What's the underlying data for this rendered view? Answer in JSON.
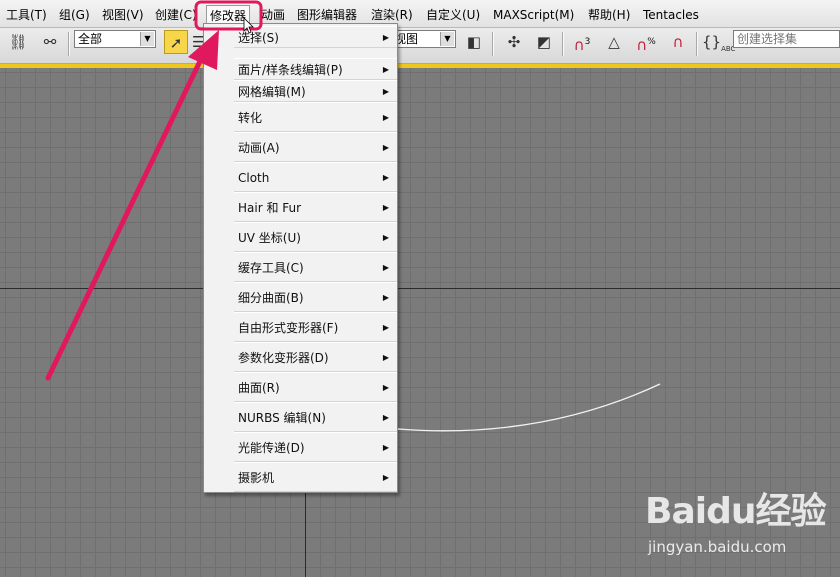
{
  "menubar": {
    "items": [
      "工具(T)",
      "组(G)",
      "视图(V)",
      "创建(C)",
      "修改器",
      "动画",
      "图形编辑器",
      "渲染(R)",
      "自定义(U)",
      "MAXScript(M)",
      "帮助(H)",
      "Tentacles"
    ],
    "active_index": 4
  },
  "toolbar": {
    "filter_combo": "全部",
    "view_combo": "视图",
    "selection_set_placeholder": "创建选择集",
    "snap_labels": [
      "3",
      "%",
      "ABC"
    ]
  },
  "dropdown": {
    "items": [
      {
        "label": "选择(S)"
      },
      {
        "label": "面片/样条线编辑(P)"
      },
      {
        "label": "网格编辑(M)"
      },
      {
        "label": "转化"
      },
      {
        "label": "动画(A)"
      },
      {
        "label": "Cloth"
      },
      {
        "label": "Hair 和 Fur"
      },
      {
        "label": "UV 坐标(U)"
      },
      {
        "label": "缓存工具(C)"
      },
      {
        "label": "细分曲面(B)"
      },
      {
        "label": "自由形式变形器(F)"
      },
      {
        "label": "参数化变形器(D)"
      },
      {
        "label": "曲面(R)"
      },
      {
        "label": "NURBS 编辑(N)"
      },
      {
        "label": "光能传递(D)"
      },
      {
        "label": "摄影机"
      }
    ]
  },
  "colors": {
    "highlight_box": "#e0195f",
    "arrow": "#e0195f",
    "toolbar_accent": "#efc61c"
  },
  "watermark": {
    "brand": "Baidu经验",
    "url": "jingyan.baidu.com"
  }
}
